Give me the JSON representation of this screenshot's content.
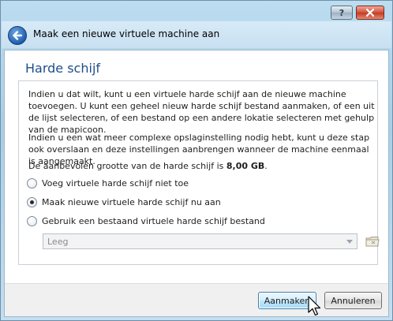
{
  "window": {
    "help_label": "?",
    "close_label": "x",
    "title": "Maak een nieuwe virtuele machine aan"
  },
  "page": {
    "title": "Harde schijf",
    "paragraph1": "Indien u dat wilt, kunt u een virtuele harde schijf aan de nieuwe machine toevoegen. U kunt een geheel nieuw harde schijf bestand aanmaken, of een uit de lijst selecteren, of een bestand op een andere lokatie selecteren met gehulp van de mapicoon.",
    "paragraph2": "Indien u een wat meer complexe opslaginstelling nodig hebt, kunt u deze stap ook overslaan en deze instellingen aanbrengen wanneer de machine eenmaal is aangemaakt.",
    "recommended_prefix": "De aanbevolen grootte van de harde schijf is ",
    "recommended_size": "8,00 GB",
    "recommended_suffix": ".",
    "options": [
      {
        "label": "Voeg virtuele harde schijf niet toe",
        "selected": false
      },
      {
        "label": "Maak nieuwe virtuele harde schijf nu aan",
        "selected": true
      },
      {
        "label": "Gebruik een bestaand virtuele harde schijf bestand",
        "selected": false
      }
    ],
    "existing_disk_combo": {
      "value": "Leeg",
      "enabled": false
    }
  },
  "buttons": {
    "create": "Aanmaken",
    "cancel": "Annuleren"
  },
  "icons": {
    "back": "back-arrow-icon",
    "folder": "folder-icon",
    "cursor": "mouse-pointer-icon"
  },
  "colors": {
    "title_blue": "#1d4f8a",
    "primary_button_border": "#3c7fb1"
  }
}
